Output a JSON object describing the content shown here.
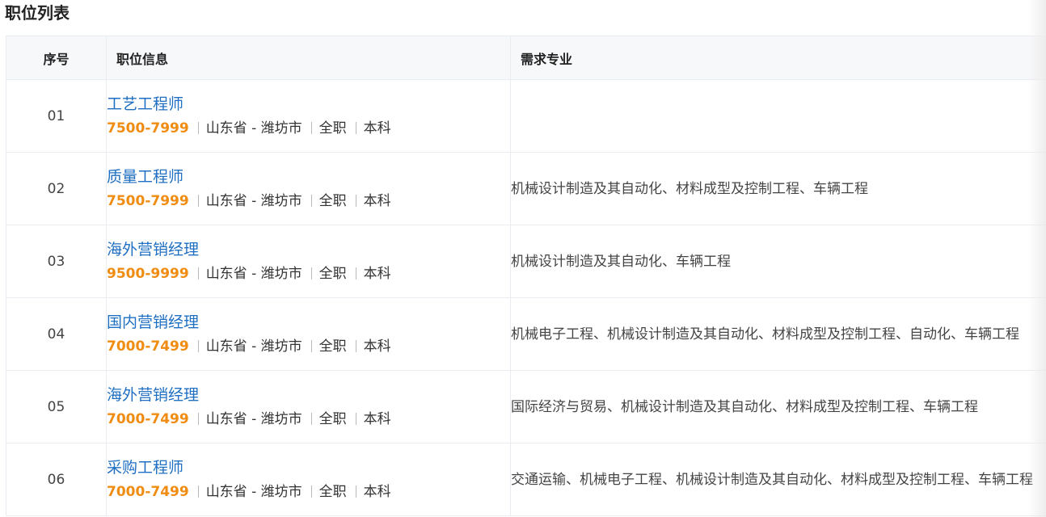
{
  "page": {
    "title": "职位列表"
  },
  "table": {
    "headers": {
      "no": "序号",
      "info": "职位信息",
      "major": "需求专业"
    },
    "rows": [
      {
        "no": "01",
        "title": "工艺工程师",
        "salary": "7500-7999",
        "location": "山东省 - 潍坊市",
        "type": "全职",
        "edu": "本科",
        "major": ""
      },
      {
        "no": "02",
        "title": "质量工程师",
        "salary": "7500-7999",
        "location": "山东省 - 潍坊市",
        "type": "全职",
        "edu": "本科",
        "major": "机械设计制造及其自动化、材料成型及控制工程、车辆工程"
      },
      {
        "no": "03",
        "title": "海外营销经理",
        "salary": "9500-9999",
        "location": "山东省 - 潍坊市",
        "type": "全职",
        "edu": "本科",
        "major": "机械设计制造及其自动化、车辆工程"
      },
      {
        "no": "04",
        "title": "国内营销经理",
        "salary": "7000-7499",
        "location": "山东省 - 潍坊市",
        "type": "全职",
        "edu": "本科",
        "major": "机械电子工程、机械设计制造及其自动化、材料成型及控制工程、自动化、车辆工程"
      },
      {
        "no": "05",
        "title": "海外营销经理",
        "salary": "7000-7499",
        "location": "山东省 - 潍坊市",
        "type": "全职",
        "edu": "本科",
        "major": "国际经济与贸易、机械设计制造及其自动化、材料成型及控制工程、车辆工程"
      },
      {
        "no": "06",
        "title": "采购工程师",
        "salary": "7000-7499",
        "location": "山东省 - 潍坊市",
        "type": "全职",
        "edu": "本科",
        "major": "交通运输、机械电子工程、机械设计制造及其自动化、材料成型及控制工程、车辆工程"
      }
    ]
  },
  "colors": {
    "link": "#1f6fc2",
    "salary": "#f08c12",
    "header_bg": "#f7f8fa",
    "border": "#e9ecf1"
  }
}
